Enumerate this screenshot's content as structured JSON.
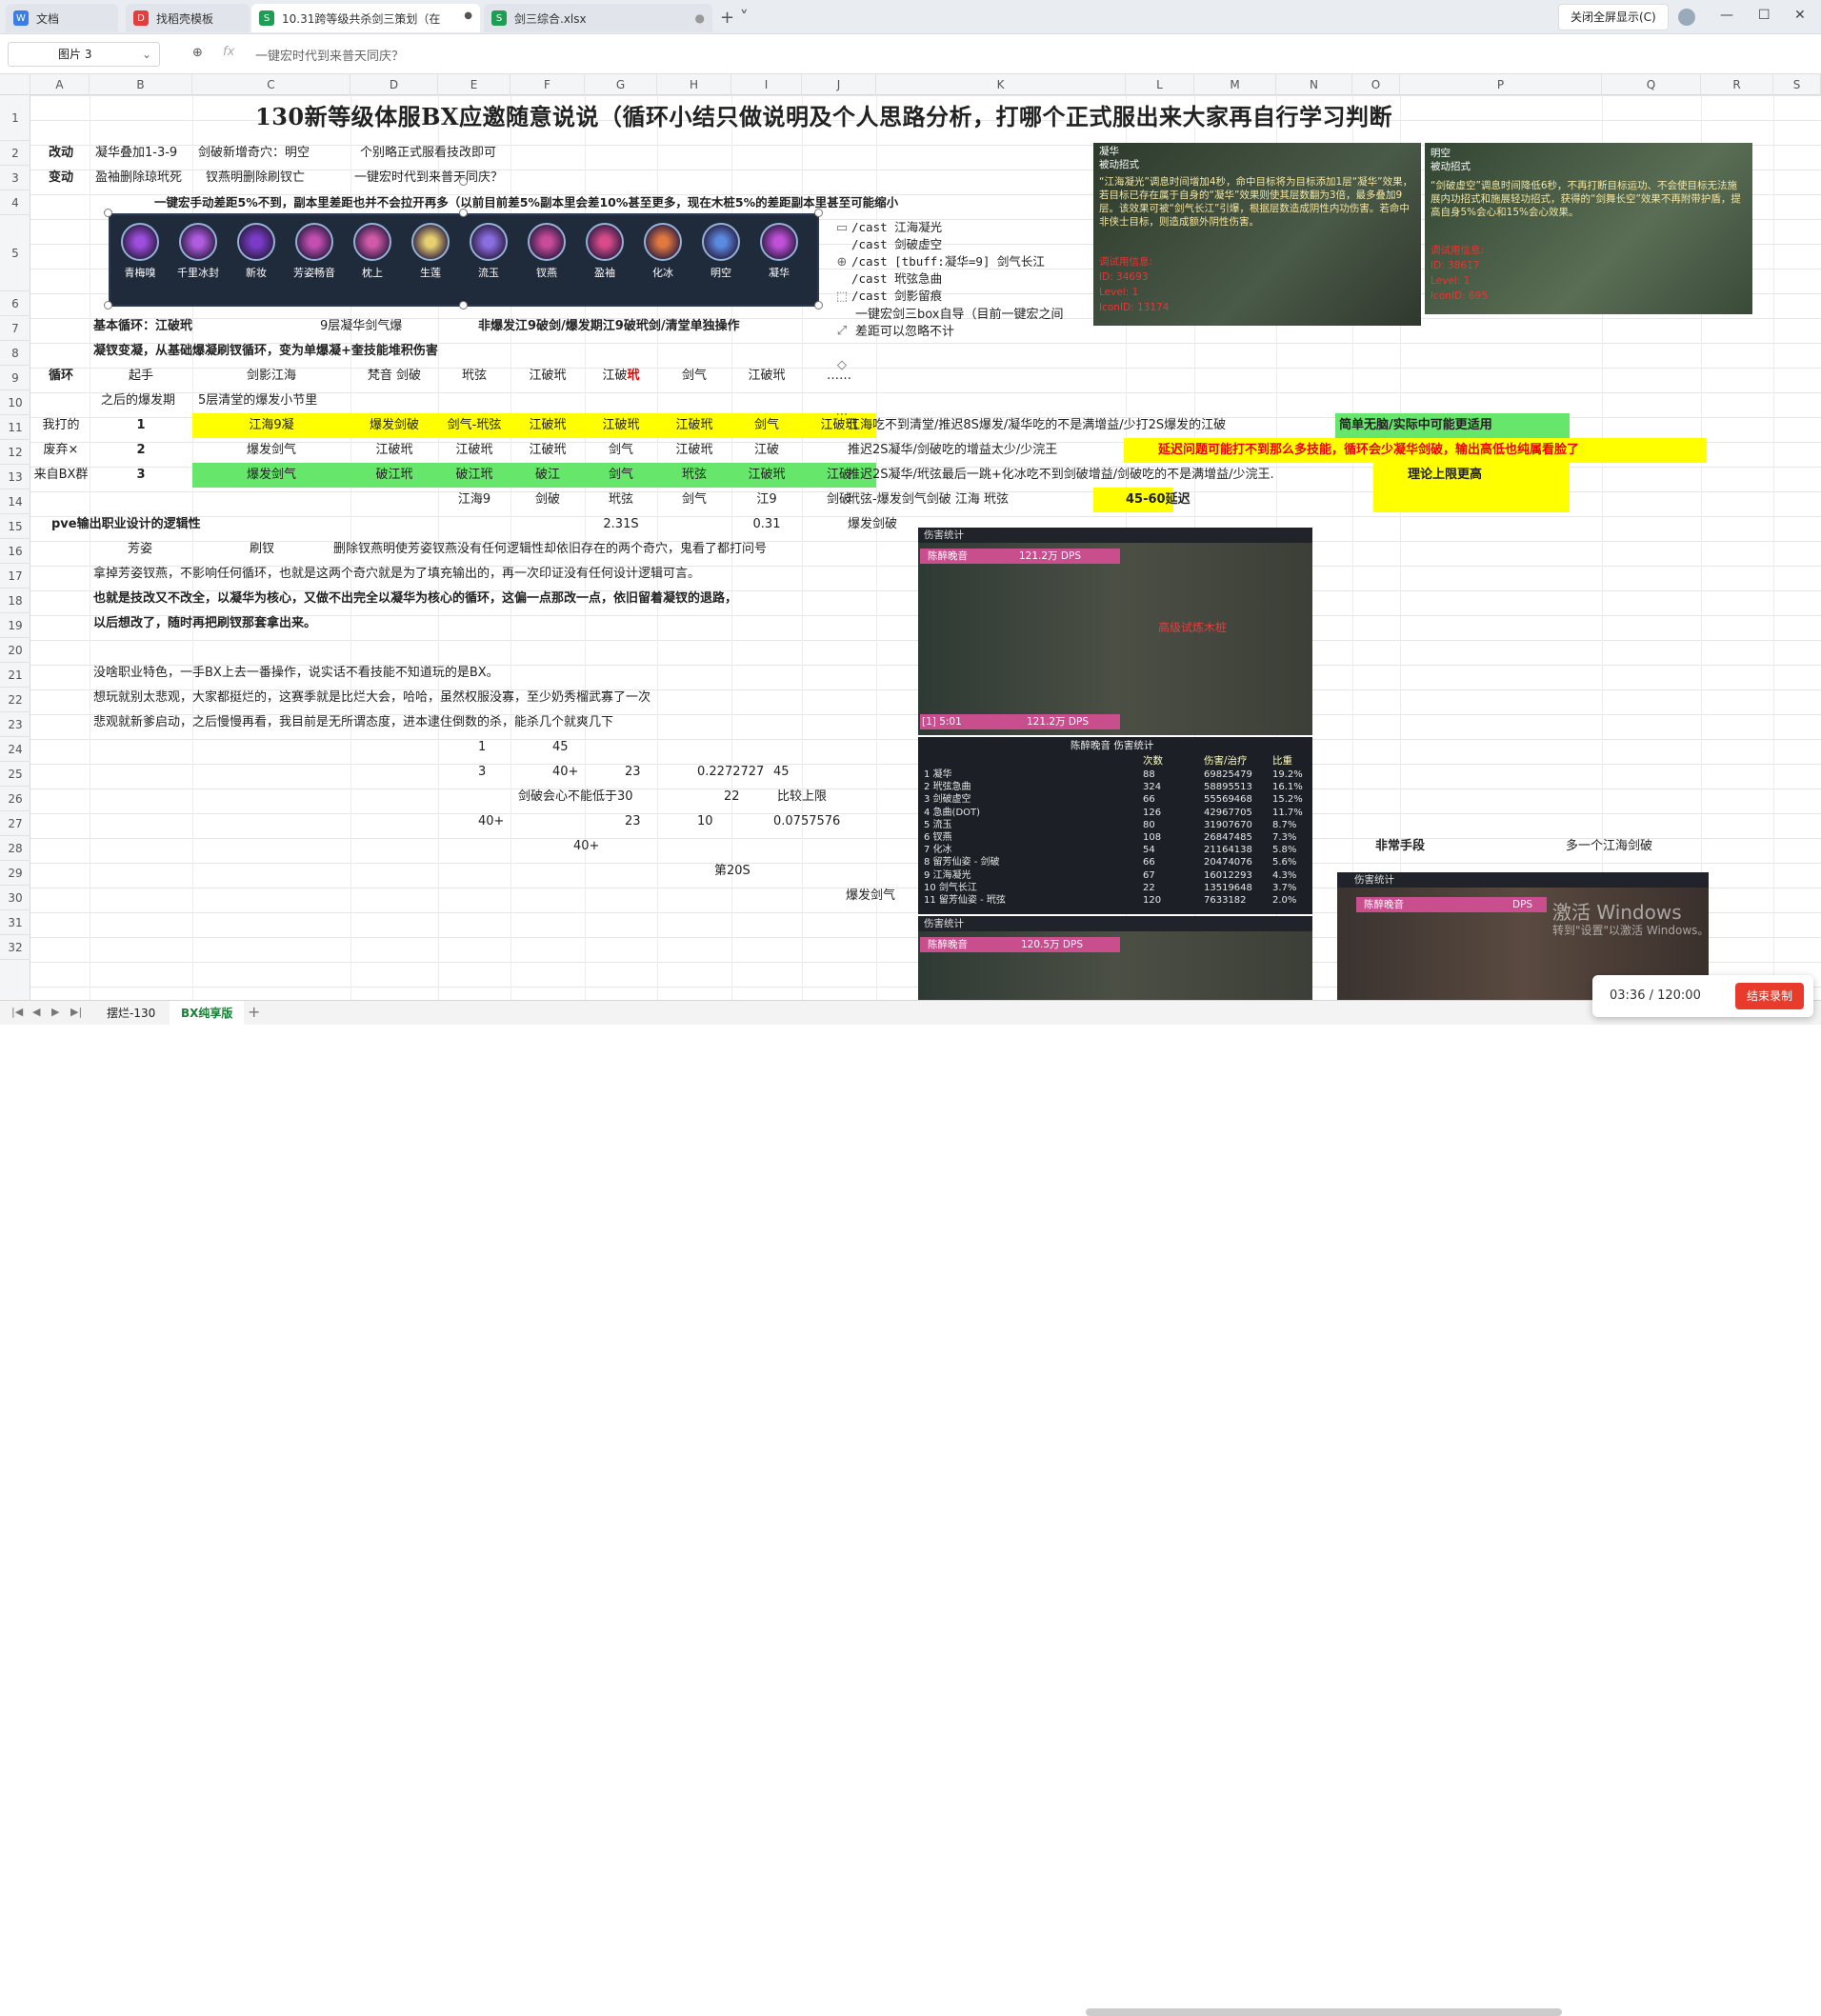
{
  "browser": {
    "tabs": [
      {
        "label": "文档",
        "icon": "W",
        "color": "#3b7ce6"
      },
      {
        "label": "找稻壳模板",
        "icon": "D",
        "color": "#e43d3d"
      },
      {
        "label": "10.31跨等级共杀剑三策划（在",
        "icon": "S",
        "color": "#1f9d55"
      },
      {
        "label": "剑三综合.xlsx",
        "icon": "S",
        "color": "#1f9d55"
      }
    ],
    "fullscreen_label": "关闭全屏显示(C)"
  },
  "formula_bar": {
    "name_box": "图片 3",
    "fx_label": "fx",
    "content": "一键宏时代到来普天同庆？"
  },
  "columns": [
    "A",
    "B",
    "C",
    "D",
    "E",
    "F",
    "G",
    "H",
    "I",
    "J",
    "K",
    "L",
    "M",
    "N",
    "O",
    "P",
    "Q",
    "R",
    "S"
  ],
  "rows": [
    "1",
    "2",
    "3",
    "4",
    "5",
    "6",
    "7",
    "8",
    "9",
    "10",
    "11",
    "12",
    "13",
    "14",
    "15",
    "16",
    "17",
    "18",
    "19",
    "20",
    "21",
    "22",
    "23",
    "24",
    "25",
    "26",
    "27",
    "28",
    "29",
    "30",
    "31",
    "32"
  ],
  "cells": {
    "title": "130新等级体服BX应邀随意说说（循环小结只做说明及个人思路分析，打哪个正式服出来大家再自行学习判断",
    "r2_a": "改动",
    "r2_b": "凝华叠加1-3-9",
    "r2_c": "剑破新增奇穴：明空",
    "r2_d": "个别略正式服看技改即可",
    "r3_a": "变动",
    "r3_b": "盈袖删除琼玳死",
    "r3_c": "钗燕明删除刷钗亡",
    "r3_d": "一键宏时代到来普天同庆？",
    "r4": "一键宏手动差距5%不到，副本里差距也并不会拉开再多（以前目前差5%副本里会差10%甚至更多，现在木桩5%的差距副本里甚至可能缩小",
    "macro": [
      "/cast 江海凝光",
      "/cast 剑破虚空",
      "/cast [tbuff:凝华=9] 剑气长江",
      "/cast 玳弦急曲",
      "/cast 剑影留痕"
    ],
    "r6_b": "基本循环：江破玳",
    "r6_c": "9层凝华剑气爆",
    "r6_f": "非爆发江9破剑/爆发期江9破玳剑/清堂单独操作",
    "r6_k": "一键宏剑三box自导（目前一键宏之间",
    "r6_k2": "差距可以忽略不计",
    "r7": "凝钗变凝，从基础爆凝刷钗循环，变为单爆凝+奎技能堆积伤害",
    "r8": {
      "a": "循环",
      "b": "起手",
      "c": "剑影江海",
      "d": "梵音 剑破",
      "e": "玳弦",
      "f": "江破玳",
      "g1": "江破",
      "g2": "玳",
      "h": "剑气",
      "i": "江破玳",
      "j": "……"
    },
    "r9": {
      "b": "之后的爆发期",
      "c": "5层清堂的爆发小节里"
    },
    "r10": {
      "a": "我打的",
      "b": "1",
      "c": "江海9凝",
      "d": "爆发剑破",
      "e": "剑气-玳弦",
      "f": "江破玳",
      "g": "江破玳",
      "h": "江破玳",
      "i": "剑气",
      "j": "江破玳",
      "k": "江海吃不到清堂/推迟8S爆发/凝华吃的不是满增益/少打2S爆发的江破",
      "p": "简单无脑/实际中可能更适用"
    },
    "r11": {
      "a": "废弃×",
      "b": "2",
      "c": "爆发剑气",
      "d": "江破玳",
      "e": "江破玳",
      "f": "江破玳",
      "g": "剑气",
      "h": "江破玳",
      "i": "江破",
      "k": "推迟2S凝华/剑破吃的增益太少/少浣王",
      "p": "延迟问题可能打不到那么多技能，循环会少凝华剑破，输出高低也纯属看脸了"
    },
    "r12": {
      "a": "来自BX群",
      "b": "3",
      "c": "爆发剑气",
      "d": "破江玳",
      "e": "破江玳",
      "f": "破江",
      "g": "剑气",
      "h": "玳弦",
      "i": "江破玳",
      "j": "江破",
      "k": "推迟2S凝华/玳弦最后一跳+化冰吃不到剑破增益/剑破吃的不是满增益/少浣王.",
      "p": "理论上限更高"
    },
    "r13": {
      "e": "江海9",
      "f": "剑破",
      "g": "玳弦",
      "h": "剑气",
      "i": "江9",
      "j": "剑破",
      "k": "玳弦-爆发剑气剑破 江海 玳弦",
      "l": "45-60延迟"
    },
    "r14": {
      "a": "pve输出职业设计的逻辑性",
      "g": "2.31S",
      "i": "0.31",
      "k": "爆发剑破"
    },
    "r15": {
      "b": "芳姿",
      "c": "刷钗",
      "e": "删除钗燕明使芳姿钗燕没有任何逻辑性却依旧存在的两个奇穴，鬼看了都打问号"
    },
    "r16": "拿掉芳姿钗燕，不影响任何循环，也就是这两个奇穴就是为了填充输出的，再一次印证没有任何设计逻辑可言。",
    "r17": "也就是技改又不改全，以凝华为核心，又做不出完全以凝华为核心的循环，这偏一点那改一点，依旧留着凝钗的退路，",
    "r18": "以后想改了，随时再把刷钗那套拿出来。",
    "r20": "没啥职业特色，一手BX上去一番操作，说实话不看技能不知道玩的是BX。",
    "r21": "想玩就别太悲观，大家都挺烂的，这赛季就是比烂大会，哈哈，虽然权服没寡，至少奶秀榴武寡了一次",
    "r22": "悲观就新爹启动，之后慢慢再看，我目前是无所谓态度，进本逮住倒数的杀，能杀几个就爽几下",
    "r23": {
      "f": "1",
      "g": "45"
    },
    "r24": {
      "f": "3",
      "g": "40+",
      "h": "23",
      "i": "0.2272727",
      "j": "45"
    },
    "r25": {
      "f": "剑破会心不能低于30",
      "i": "22",
      "j": "比较上限"
    },
    "r26": {
      "f": "40+",
      "h": "23",
      "i": "10",
      "j": "0.0757576"
    },
    "r27": {
      "g": "40+"
    },
    "r28": {
      "i": "第20S"
    },
    "r29": {
      "k": "爆发剑气"
    },
    "r27_p": "非常手段",
    "r27_q": "多一个江海剑破"
  },
  "skills": [
    "青梅嗅",
    "千里冰封",
    "新妆",
    "芳姿畅音",
    "枕上",
    "生莲",
    "流玉",
    "钗燕",
    "盈袖",
    "化冰",
    "明空",
    "凝华"
  ],
  "tooltip1": {
    "title": "凝华",
    "sub": "被动招式",
    "body": "“江海凝光”调息时间增加4秒，命中目标将为目标添加1层“凝华”效果，若目标已存在属于自身的“凝华”效果则使其层数翻为3倍，最多叠加9层。该效果可被“剑气长江”引爆，根据层数造成阴性内功伤害。若命中非侠士目标，则造成额外阴性伤害。",
    "f1": "调试用信息:",
    "f2": "ID:    34693",
    "f3": "Level:  1",
    "f4": "IconID: 13174"
  },
  "tooltip2": {
    "title": "明空",
    "sub": "被动招式",
    "body": "“剑破虚空”调息时间降低6秒，不再打断目标运功、不会使目标无法施展内功招式和施展轻功招式，获得的“剑舞长空”效果不再附带护盾，提高自身5%会心和15%会心效果。",
    "f1": "调试用信息:",
    "f2": "ID:    38617",
    "f3": "Level:  1",
    "f4": "IconID: 695"
  },
  "dps1": {
    "header": "伤害统计",
    "name": "陈醉晚音",
    "val": "121.2万 DPS",
    "time": "[1] 5:01",
    "val2": "121.2万 DPS",
    "target": "高级试炼木桩"
  },
  "dps_table": {
    "title": "陈醉晚音 伤害统计",
    "cols": [
      "次数",
      "伤害/治疗",
      "比重"
    ],
    "rows": [
      [
        "1 凝华",
        "88",
        "69825479",
        "19.2%"
      ],
      [
        "2 玳弦急曲",
        "324",
        "58895513",
        "16.1%"
      ],
      [
        "3 剑破虚空",
        "66",
        "55569468",
        "15.2%"
      ],
      [
        "4 急曲(DOT)",
        "126",
        "42967705",
        "11.7%"
      ],
      [
        "5 流玉",
        "80",
        "31907670",
        "8.7%"
      ],
      [
        "6 钗燕",
        "108",
        "26847485",
        "7.3%"
      ],
      [
        "7 化冰",
        "54",
        "21164138",
        "5.8%"
      ],
      [
        "8 留芳仙姿 - 剑破",
        "66",
        "20474076",
        "5.6%"
      ],
      [
        "9 江海凝光",
        "67",
        "16012293",
        "4.3%"
      ],
      [
        "10 剑气长江",
        "22",
        "13519648",
        "3.7%"
      ],
      [
        "11 留芳仙姿 - 玳弦",
        "120",
        "7633182",
        "2.0%"
      ]
    ]
  },
  "dps2": {
    "header": "伤害统计",
    "name": "陈醉晚音",
    "val": "120.5万 DPS"
  },
  "dps3": {
    "header": "伤害统计",
    "name": "陈醉晚音",
    "val": "DPS"
  },
  "watermark": {
    "line1": "激活 Windows",
    "line2": "转到\"设置\"以激活 Windows。"
  },
  "timer": {
    "status": "03:36 / 120:00",
    "end": "结束录制"
  },
  "sheet_tabs": [
    "摆烂-130",
    "BX纯享版"
  ],
  "colors": {
    "yellow": "#ffff00",
    "green": "#66e66a",
    "accent": "#1a7f37"
  }
}
